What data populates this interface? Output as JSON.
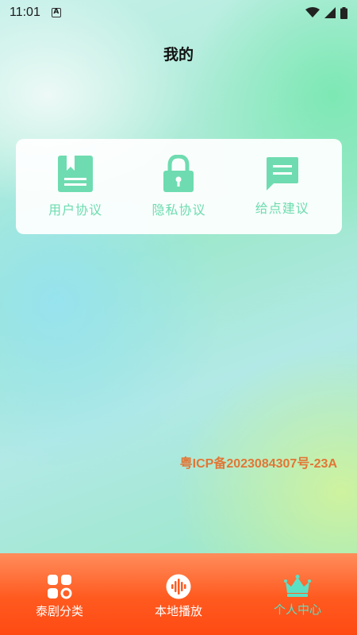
{
  "status_bar": {
    "time": "11:01",
    "notification_glyph": "A",
    "icons": [
      "wifi-icon",
      "signal-icon",
      "battery-icon"
    ]
  },
  "header": {
    "title": "我的"
  },
  "menu": {
    "items": [
      {
        "label": "用户协议",
        "icon": "book-icon"
      },
      {
        "label": "隐私协议",
        "icon": "lock-icon"
      },
      {
        "label": "给点建议",
        "icon": "message-icon"
      }
    ],
    "icon_color": "#6edcb0"
  },
  "footer": {
    "icp": "粤ICP备2023084307号-23A",
    "icp_color": "#e27636"
  },
  "tab_bar": {
    "tabs": [
      {
        "label": "泰剧分类",
        "icon": "grid-icon",
        "active": false
      },
      {
        "label": "本地播放",
        "icon": "audio-wave-icon",
        "active": false
      },
      {
        "label": "个人中心",
        "icon": "crown-icon",
        "active": true
      }
    ],
    "background": "#ff5a1f",
    "active_color": "#5be0c6"
  }
}
